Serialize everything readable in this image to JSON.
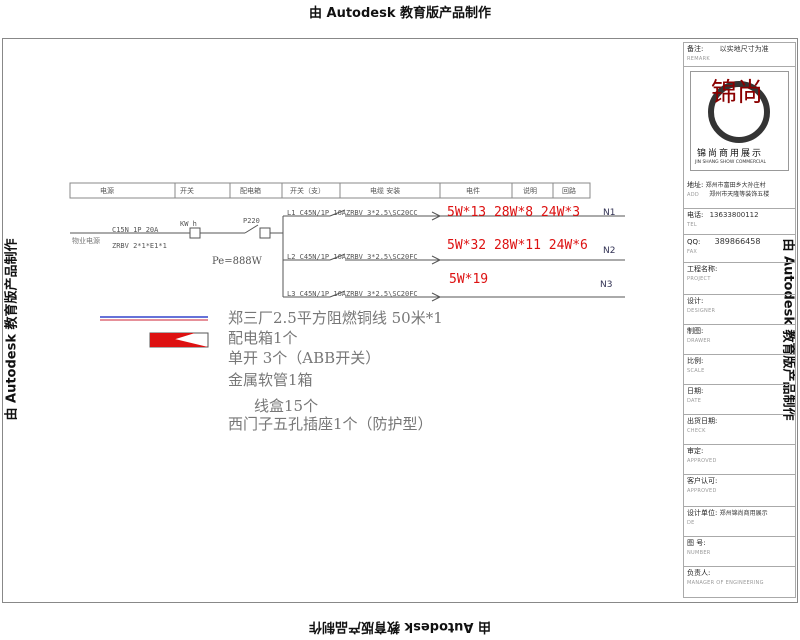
{
  "watermark": "由 Autodesk 教育版产品制作",
  "header": [
    "电源",
    "开关",
    "配电箱",
    "开关（支）",
    "电缆 安装",
    "电件",
    "说明",
    "回路"
  ],
  "left_labels": {
    "supply": "物业电源",
    "breaker": "C15N 1P 20A",
    "cable": "ZRBV 2*1*E1*1",
    "meter": "KW h",
    "box": "P220",
    "pe": "Pe=888W"
  },
  "circuits": [
    {
      "breaker": "L1 C45N/1P 16A",
      "cable": "ZRBV 3*2.5\\SC20CC",
      "loads": "5W*13  28W*8  24W*3",
      "id": "N1"
    },
    {
      "breaker": "L2 C45N/1P 16A",
      "cable": "ZRBV 3*2.5\\SC20FC",
      "loads": "5W*32  28W*11  24W*6",
      "id": "N2"
    },
    {
      "breaker": "L3 C45N/1P 16A",
      "cable": "ZRBV 3*2.5\\SC20FC",
      "loads": "5W*19",
      "id": "N3"
    }
  ],
  "notes": [
    "郑三厂2.5平方阻燃铜线    50米*1",
    "配电箱1个",
    "单开  3个（ABB开关）",
    "金属软管1箱",
    "线盒15个",
    "西门子五孔插座1个（防护型）"
  ],
  "title_block": {
    "remark_label": "备注:",
    "remark_en": "REMARK",
    "remark_val": "以实地尺寸为准",
    "brand_cn": "锦尚商用展示",
    "brand_en": "JIN SHANG SHOW COMMERCIAL",
    "logo_chars": "锦尚",
    "address_label": "地址:",
    "address_en": "ADD",
    "address_val1": "郑州市富田乡大孙庄村",
    "address_val2": "郑州市天隆等装饰五楼",
    "phone_label": "电话:",
    "phone_en": "TEL",
    "phone_val": "13633800112",
    "qq_label": "QQ:",
    "qq_en": "FAX",
    "qq_val": "389866458",
    "project_label": "工程名称:",
    "project_en": "PROJECT",
    "design_label": "设计:",
    "design_en": "DESIGNER",
    "draw_label": "制图:",
    "draw_en": "DRAWER",
    "scale_label": "比例:",
    "scale_en": "SCALE",
    "date_label": "日期:",
    "date_en": "DATE",
    "check_label": "出货日期:",
    "check_en": "CHECK",
    "approve_label": "审定:",
    "approve_en": "APPROVED",
    "client_label": "客户认可:",
    "client_en": "APPROVED",
    "unit_label": "设计单位:",
    "unit_val": "郑州锦尚商用展示",
    "unit_en": "DE",
    "figno_label": "图   号:",
    "figno_en": "NUMBER",
    "manager_label": "负责人:",
    "manager_en": "MANAGER OF ENGINEERING"
  },
  "colors": {
    "red": "#dd1111",
    "line": "#555555",
    "blue_line": "#3344cc"
  }
}
